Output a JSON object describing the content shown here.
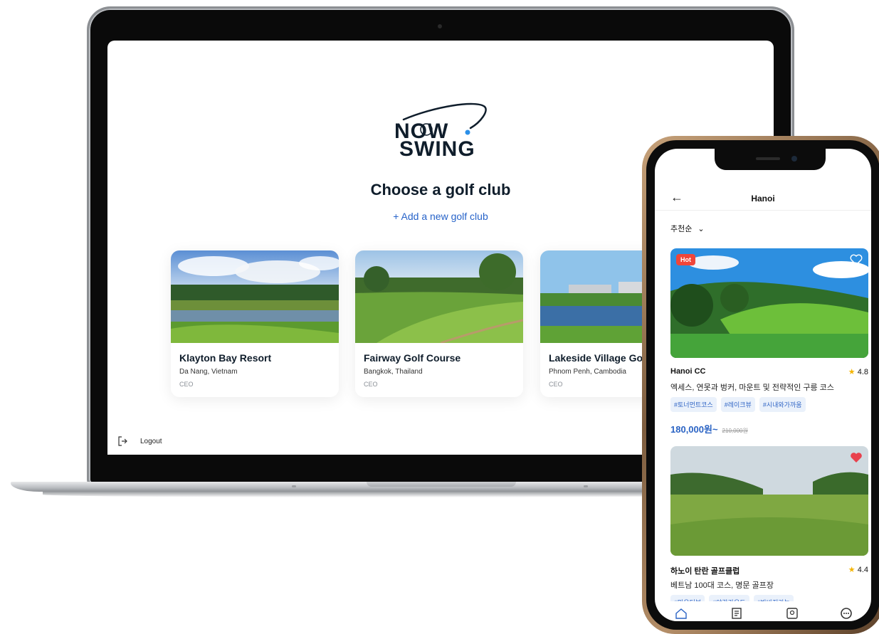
{
  "laptop": {
    "logo_line1": "NOW",
    "logo_line2": "SWING",
    "title": "Choose a golf club",
    "add_link": "+ Add a new golf club",
    "clubs": [
      {
        "name": "Klayton Bay Resort",
        "location": "Da Nang, Vietnam",
        "role": "CEO"
      },
      {
        "name": "Fairway Golf Course",
        "location": "Bangkok, Thailand",
        "role": "CEO"
      },
      {
        "name": "Lakeside Village Golf",
        "location": "Phnom Penh, Cambodia",
        "role": "CEO"
      }
    ],
    "logout": "Logout"
  },
  "phone": {
    "title": "Hanoi",
    "back_icon": "←",
    "sort_label": "추천순",
    "sort_chevron": "⌄",
    "courses": [
      {
        "badge": "Hot",
        "name": "Hanoi CC",
        "rating": "4.8",
        "description": "엑세스, 연못과 벙커, 마운트 및 전략적인 구릉 코스",
        "tags": [
          "#토너먼트코스",
          "#레이크뷰",
          "#시내와가까움"
        ],
        "price": "180,000원~",
        "price_old": "210,000원",
        "favorited": false
      },
      {
        "name": "하노이 탄란 골프클럽",
        "rating": "4.4",
        "description": "베트남 100대 코스, 명문 골프장",
        "tags": [
          "#마운틴뷰",
          "#야간라운드",
          "#반바지가능"
        ],
        "favorited": true
      }
    ],
    "rating_star": "★"
  },
  "colors": {
    "accent_blue": "#2763c9",
    "navy": "#0f1d2b",
    "hot_red": "#f0463a",
    "star_yellow": "#f4b400",
    "heart_red": "#e8414d"
  },
  "icons": {
    "logout": "logout-icon",
    "back": "back-arrow-icon",
    "sort": "chevron-down-icon",
    "heart": "heart-icon",
    "star": "star-icon",
    "nav": [
      "home-icon",
      "reservation-icon",
      "profile-icon",
      "more-icon"
    ]
  }
}
